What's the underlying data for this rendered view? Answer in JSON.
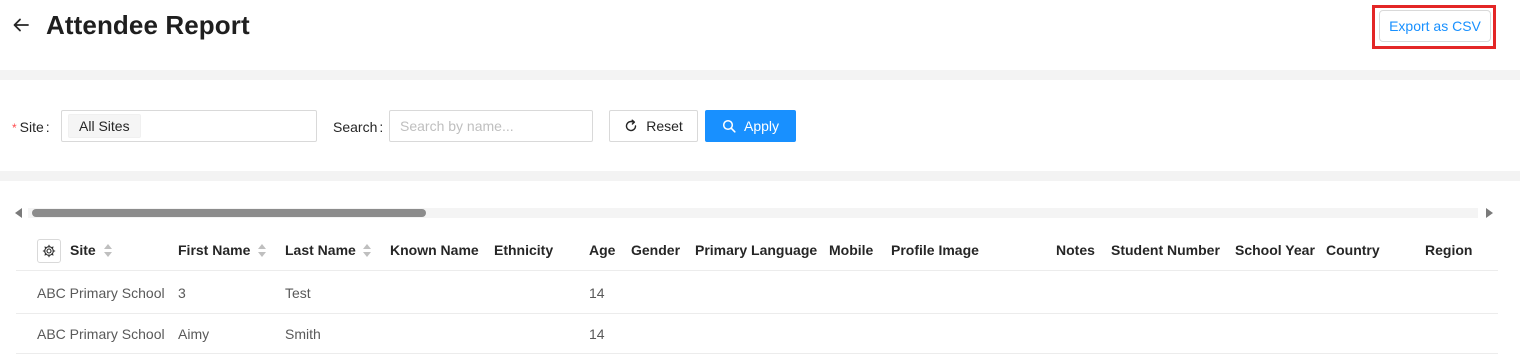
{
  "header": {
    "title": "Attendee Report",
    "export_label": "Export as CSV",
    "back_icon": "arrow-left-icon"
  },
  "filters": {
    "site_label": "Site",
    "site_required_mark": "*",
    "site_value": "All Sites",
    "colon": ":",
    "search_label": "Search",
    "search_placeholder": "Search by name...",
    "reset_label": "Reset",
    "apply_label": "Apply"
  },
  "table": {
    "columns": [
      "Site",
      "First Name",
      "Last Name",
      "Known Name",
      "Ethnicity",
      "Age",
      "Gender",
      "Primary Language",
      "Mobile",
      "Profile Image",
      "Notes",
      "Student Number",
      "School Year",
      "Country",
      "Region"
    ],
    "rows": [
      {
        "site": "ABC Primary School",
        "first_name": "3",
        "last_name": "Test",
        "age": "14"
      },
      {
        "site": "ABC Primary School",
        "first_name": "Aimy",
        "last_name": "Smith",
        "age": "14"
      }
    ]
  },
  "colors": {
    "primary": "#1890ff",
    "highlight_box": "#e32626"
  }
}
